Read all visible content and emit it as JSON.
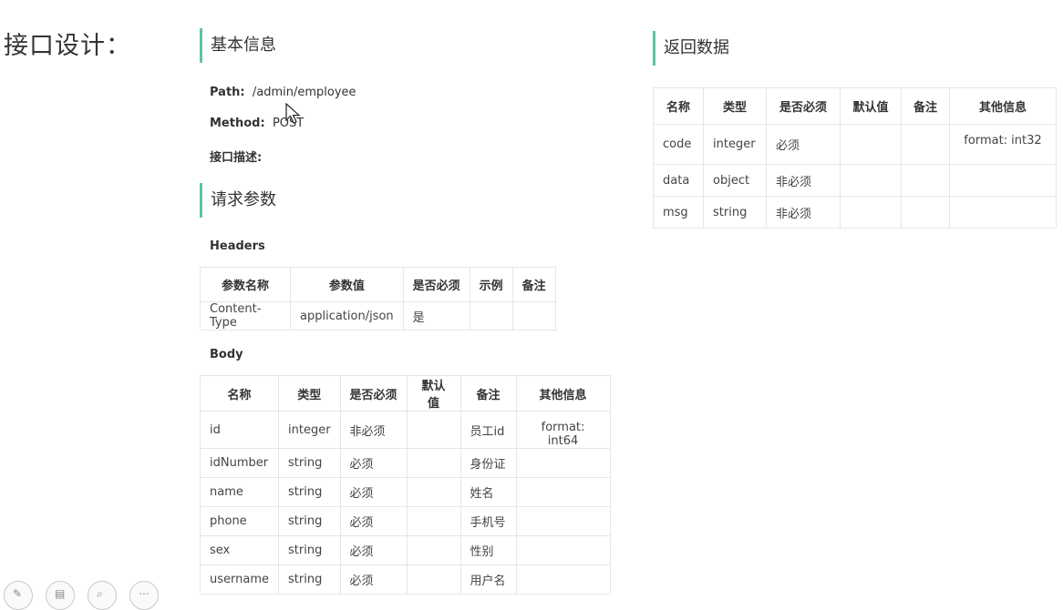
{
  "slide_title": "接口设计：",
  "basic": {
    "heading": "基本信息",
    "path_label": "Path:",
    "path_value": "/admin/employee",
    "method_label": "Method:",
    "method_value": "POST",
    "desc_label": "接口描述:"
  },
  "request": {
    "heading": "请求参数",
    "headers_label": "Headers",
    "headers_table": {
      "columns": [
        "参数名称",
        "参数值",
        "是否必须",
        "示例",
        "备注"
      ],
      "rows": [
        [
          "Content-Type",
          "application/json",
          "是",
          "",
          ""
        ]
      ]
    },
    "body_label": "Body",
    "body_table": {
      "columns": [
        "名称",
        "类型",
        "是否必须",
        "默认值",
        "备注",
        "其他信息"
      ],
      "rows": [
        [
          "id",
          "integer",
          "非必须",
          "",
          "员工id",
          "format: int64"
        ],
        [
          "idNumber",
          "string",
          "必须",
          "",
          "身份证",
          ""
        ],
        [
          "name",
          "string",
          "必须",
          "",
          "姓名",
          ""
        ],
        [
          "phone",
          "string",
          "必须",
          "",
          "手机号",
          ""
        ],
        [
          "sex",
          "string",
          "必须",
          "",
          "性别",
          ""
        ],
        [
          "username",
          "string",
          "必须",
          "",
          "用户名",
          ""
        ]
      ]
    }
  },
  "response": {
    "heading": "返回数据",
    "table": {
      "columns": [
        "名称",
        "类型",
        "是否必须",
        "默认值",
        "备注",
        "其他信息"
      ],
      "rows": [
        [
          "code",
          "integer",
          "必须",
          "",
          "",
          "format: int32"
        ],
        [
          "data",
          "object",
          "非必须",
          "",
          "",
          ""
        ],
        [
          "msg",
          "string",
          "非必须",
          "",
          "",
          ""
        ]
      ]
    }
  },
  "toolbar_icons": [
    "pen-icon",
    "page-icon",
    "zoom-icon",
    "more-icon"
  ]
}
